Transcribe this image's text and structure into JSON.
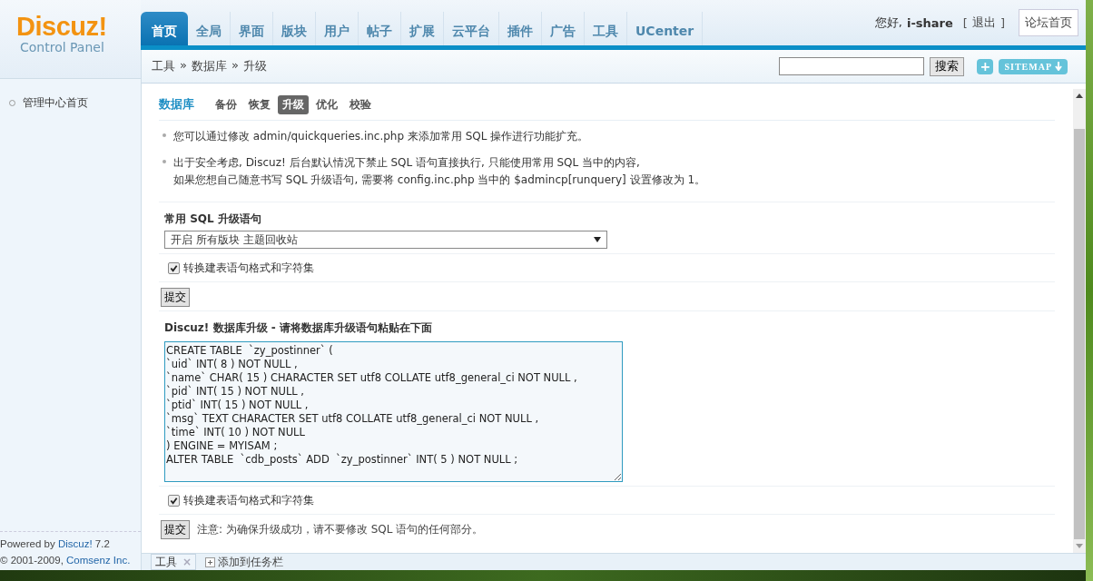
{
  "logo": {
    "name": "Discuz!",
    "subtitle": "Control Panel"
  },
  "nav": {
    "tabs": [
      {
        "label": "首页",
        "selected": true
      },
      {
        "label": "全局",
        "selected": false
      },
      {
        "label": "界面",
        "selected": false
      },
      {
        "label": "版块",
        "selected": false
      },
      {
        "label": "用户",
        "selected": false
      },
      {
        "label": "帖子",
        "selected": false
      },
      {
        "label": "扩展",
        "selected": false
      },
      {
        "label": "云平台",
        "selected": false
      },
      {
        "label": "插件",
        "selected": false
      },
      {
        "label": "广告",
        "selected": false
      },
      {
        "label": "工具",
        "selected": false
      },
      {
        "label": "UCenter",
        "selected": false
      }
    ]
  },
  "user": {
    "greeting": "您好,",
    "name": "i-share",
    "logout_open": "[",
    "logout": "退出",
    "logout_close": "]",
    "forum_home": "论坛首页"
  },
  "breadcrumb": {
    "items": [
      "工具",
      "数据库",
      "升级"
    ],
    "separator": "»"
  },
  "search": {
    "button": "搜索",
    "add": "+",
    "sitemap": "SITEMAP"
  },
  "sidebar": {
    "items": [
      {
        "label": "管理中心首页"
      }
    ]
  },
  "footer": {
    "powered": "Powered by",
    "powered_link": "Discuz!",
    "version": "7.2",
    "copyright": "© 2001-2009,",
    "company": "Comsenz Inc."
  },
  "content": {
    "title": "数据库",
    "tabs": [
      {
        "label": "备份",
        "selected": false
      },
      {
        "label": "恢复",
        "selected": false
      },
      {
        "label": "升级",
        "selected": true
      },
      {
        "label": "优化",
        "selected": false
      },
      {
        "label": "校验",
        "selected": false
      }
    ],
    "tips": [
      [
        "您可以通过修改 admin/quickqueries.inc.php 来添加常用 SQL 操作进行功能扩充。"
      ],
      [
        "出于安全考虑, Discuz! 后台默认情况下禁止 SQL 语句直接执行, 只能使用常用 SQL 当中的内容,",
        "如果您想自己随意书写 SQL 升级语句, 需要将 config.inc.php 当中的 $admincp[runquery] 设置修改为 1。"
      ]
    ],
    "quick_label": "常用 SQL 升级语句",
    "quick_select": "开启 所有版块 主题回收站",
    "convert1": {
      "label": "转换建表语句格式和字符集",
      "checked": true
    },
    "submit1": "提交",
    "upgrade_label": "Discuz! 数据库升级 - 请将数据库升级语句粘贴在下面",
    "sql": "CREATE TABLE  `zy_postinner` (\n`uid` INT( 8 ) NOT NULL ,\n`name` CHAR( 15 ) CHARACTER SET utf8 COLLATE utf8_general_ci NOT NULL ,\n`pid` INT( 15 ) NOT NULL ,\n`ptid` INT( 15 ) NOT NULL ,\n`msg` TEXT CHARACTER SET utf8 COLLATE utf8_general_ci NOT NULL ,\n`time` INT( 10 ) NOT NULL\n) ENGINE = MYISAM ;\nALTER TABLE  `cdb_posts` ADD  `zy_postinner` INT( 5 ) NOT NULL ;",
    "convert2": {
      "label": "转换建表语句格式和字符集",
      "checked": true
    },
    "submit2": "提交",
    "note": "注意: 为确保升级成功，请不要修改 SQL 语句的任何部分。"
  },
  "taskbar": {
    "tabs": [
      {
        "label": "工具",
        "close": "×"
      }
    ],
    "add": "添加到任务栏"
  }
}
